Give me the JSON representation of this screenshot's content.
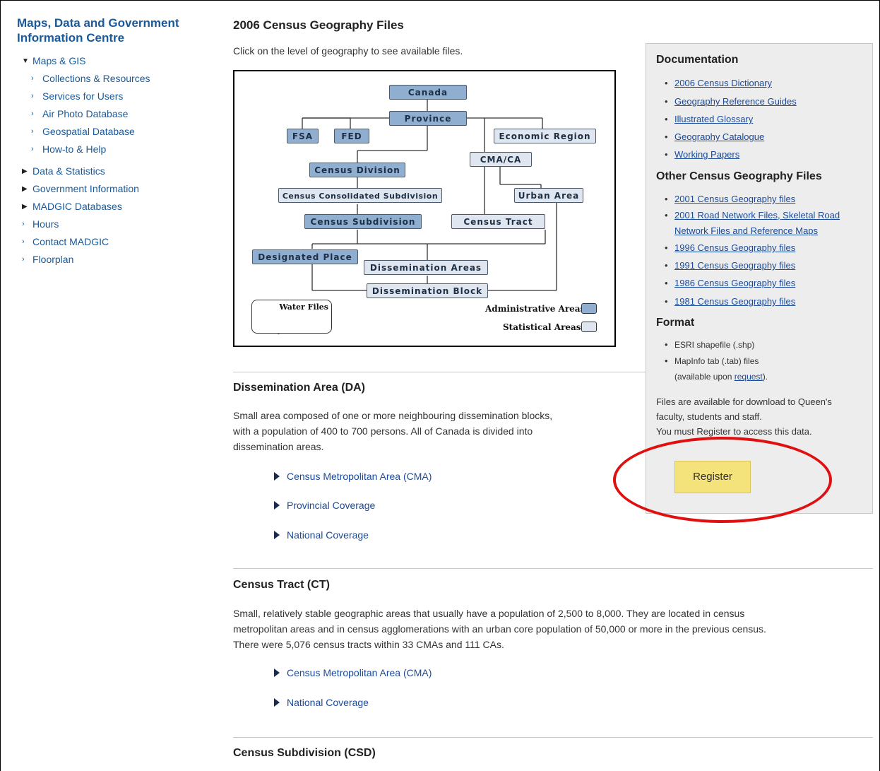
{
  "sidebar": {
    "title": "Maps, Data and Government Information Centre",
    "nav": [
      {
        "label": "Maps & GIS",
        "level": 1,
        "marker": "expanded"
      },
      {
        "label": "Collections & Resources",
        "level": 2,
        "marker": "arrow"
      },
      {
        "label": "Services for Users",
        "level": 2,
        "marker": "arrow"
      },
      {
        "label": "Air Photo Database",
        "level": 2,
        "marker": "arrow"
      },
      {
        "label": "Geospatial Database",
        "level": 2,
        "marker": "arrow"
      },
      {
        "label": "How-to & Help",
        "level": 2,
        "marker": "arrow"
      },
      {
        "label": "Data & Statistics",
        "level": 1,
        "marker": "collapsed"
      },
      {
        "label": "Government Information",
        "level": 1,
        "marker": "collapsed"
      },
      {
        "label": "MADGIC Databases",
        "level": 1,
        "marker": "collapsed"
      },
      {
        "label": "Hours",
        "level": 1,
        "marker": "arrow"
      },
      {
        "label": "Contact MADGIC",
        "level": 1,
        "marker": "arrow"
      },
      {
        "label": "Floorplan",
        "level": 1,
        "marker": "arrow"
      }
    ]
  },
  "page": {
    "title": "2006 Census Geography Files",
    "intro": "Click on the level of geography to see available files."
  },
  "diagram": {
    "nodes": {
      "canada": "Canada",
      "province": "Province",
      "fsa": "FSA",
      "fed": "FED",
      "economic_region": "Economic Region",
      "cma_ca": "CMA/CA",
      "census_division": "Census Division",
      "ccs": "Census Consolidated Subdivision",
      "urban_area": "Urban Area",
      "csd": "Census Subdivision",
      "census_tract": "Census Tract",
      "designated_place": "Designated Place",
      "da": "Dissemination Areas",
      "db": "Dissemination Block"
    },
    "water_files": "Water Files",
    "legend": {
      "admin": "Administrative Areas",
      "stat": "Statistical Areas",
      "admin_color": "#8faed0",
      "stat_color": "#dfe6ef"
    }
  },
  "panel": {
    "documentation_title": "Documentation",
    "documentation": [
      "2006 Census Dictionary",
      "Geography Reference Guides",
      "Illustrated Glossary",
      "Geography Catalogue",
      "Working Papers"
    ],
    "other_title": "Other Census Geography Files",
    "other": [
      "2001 Census Geography files",
      "2001 Road Network Files, Skeletal Road Network Files and Reference Maps",
      "1996 Census Geography files",
      "1991 Census Geography files",
      "1986 Census Geography files",
      "1981 Census Geography files"
    ],
    "format_title": "Format",
    "format_1": "ESRI shapefile (.shp)",
    "format_2": "MapInfo tab (.tab) files",
    "format_2b_pre": "(available upon ",
    "format_2b_link": "request",
    "format_2b_post": ").",
    "note": "Files are available for download to Queen's faculty, students and staff.",
    "note2": "You must Register to access this data.",
    "register_label": "Register",
    "register_color": "#f4e27a",
    "highlight_color": "#e01010"
  },
  "sections": [
    {
      "title": "Dissemination Area (DA)",
      "desc_lines": [
        "Small area composed of one or more neighbouring dissemination blocks,",
        "with a population of 400 to 700 persons. All of Canada is divided into",
        "dissemination areas."
      ],
      "links": [
        "Census Metropolitan Area (CMA)",
        "Provincial Coverage",
        "National Coverage"
      ]
    },
    {
      "title": "Census Tract (CT)",
      "desc_lines": [
        "Small, relatively stable geographic areas that usually have a population of 2,500 to 8,000. They are located in census",
        "metropolitan areas and in census agglomerations with an urban core population of 50,000 or more in the previous census.",
        "There were 5,076 census tracts within 33 CMAs and 111 CAs."
      ],
      "links": [
        "Census Metropolitan Area (CMA)",
        "National Coverage"
      ]
    },
    {
      "title": "Census Subdivision (CSD)"
    }
  ]
}
